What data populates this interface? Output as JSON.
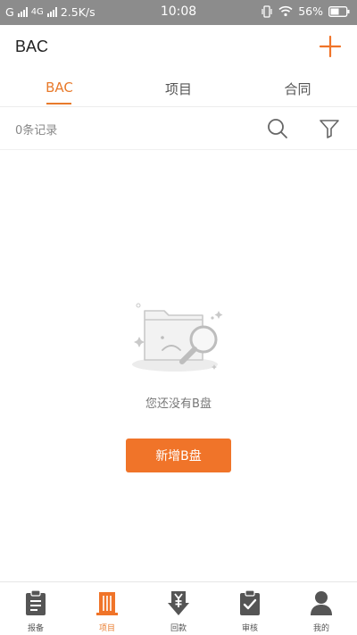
{
  "status_bar": {
    "carrier": "G",
    "network": "4G",
    "speed": "2.5K/s",
    "time": "10:08",
    "battery": "56%"
  },
  "header": {
    "title": "BAC",
    "add_icon": "plus-icon"
  },
  "tabs": [
    {
      "label": "BAC",
      "active": true
    },
    {
      "label": "项目",
      "active": false
    },
    {
      "label": "合同",
      "active": false
    }
  ],
  "filter_bar": {
    "record_count": "0条记录",
    "search_icon": "search-icon",
    "filter_icon": "filter-icon"
  },
  "empty_state": {
    "illustration": "empty-folder-search-illustration",
    "message": "您还没有B盘",
    "action_label": "新增B盘"
  },
  "bottom_nav": [
    {
      "label": "报备",
      "icon": "clipboard-icon",
      "active": false
    },
    {
      "label": "项目",
      "icon": "building-icon",
      "active": true
    },
    {
      "label": "回款",
      "icon": "yuan-download-icon",
      "active": false
    },
    {
      "label": "审核",
      "icon": "clipboard-check-icon",
      "active": false
    },
    {
      "label": "我的",
      "icon": "user-icon",
      "active": false
    }
  ],
  "colors": {
    "accent": "#f07429",
    "status_bar": "#8c8c8c",
    "icon_gray": "#555555"
  }
}
